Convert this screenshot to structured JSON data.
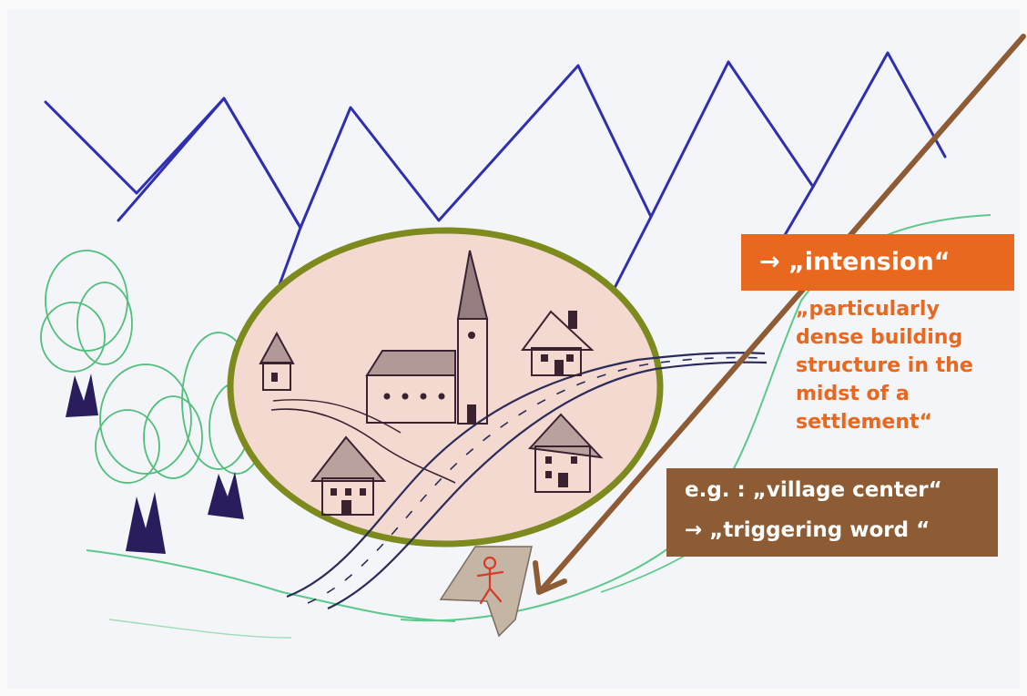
{
  "labels": {
    "intension": "→ „intension“",
    "definition": "„particularly\ndense building\nstructure in the\nmidst of a\nsettlement“",
    "example_line1": "e.g. : „village center“",
    "example_line2": "→ „triggering word “"
  },
  "colors": {
    "mountains": "#2f2fb0",
    "trees": "#4fbf7a",
    "tree_trunks": "#2a1d5e",
    "ellipse_fill": "#f3d9cf",
    "ellipse_outline": "#7d8a1e",
    "houses": "#3a2230",
    "road": "#2b2b5a",
    "hills": "#5cc98a",
    "diagonal_arrow": "#8e5c34",
    "orange_box": "#e8681f",
    "brown_box": "#8e5c34",
    "viewpoint_arrow": "#c4b5a4",
    "person": "#d83a2a"
  }
}
